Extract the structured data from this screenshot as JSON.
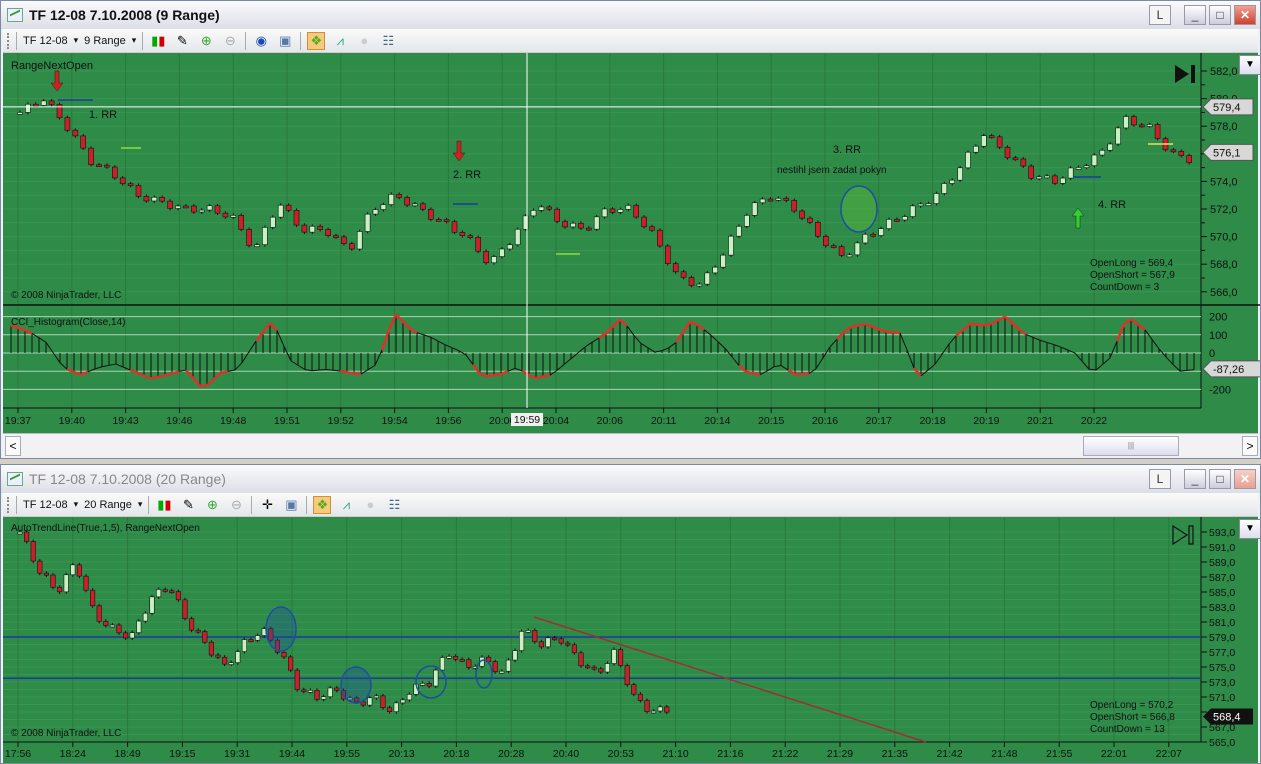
{
  "top_window": {
    "title": "TF 12-08  7.10.2008 (9 Range)",
    "buttons": {
      "layout": "L",
      "minimize": "_",
      "maximize": "□",
      "close": "✕"
    },
    "toolbar": {
      "instrument": "TF 12-08",
      "interval": "9 Range"
    },
    "indicator_label": "RangeNextOpen",
    "copyright": "© 2008 NinjaTrader, LLC",
    "cci_label": "CCI_Histogram(Close,14)",
    "annotations": [
      "1.  RR",
      "2.  RR",
      "3. RR",
      "nestihl jsem zadat pokyn",
      "4. RR"
    ],
    "stats": [
      "OpenLong = 569,4",
      "OpenShort = 567,9",
      "CountDown = 3"
    ],
    "price_axis": [
      "582,0",
      "580,0",
      "578,0",
      "576,0",
      "574,0",
      "572,0",
      "570,0",
      "568,0",
      "566,0"
    ],
    "price_tags": {
      "crosshair": "579,4",
      "last": "576,1"
    },
    "cci_axis": [
      "200",
      "100",
      "0",
      "-200"
    ],
    "cci_tag": "-87,26",
    "time_axis": [
      "19:37",
      "19:40",
      "19:43",
      "19:46",
      "19:48",
      "19:51",
      "19:52",
      "19:54",
      "19:56",
      "20:00",
      "20:04",
      "20:06",
      "20:11",
      "20:14",
      "20:15",
      "20:16",
      "20:17",
      "20:18",
      "20:19",
      "20:21",
      "20:22"
    ],
    "crosshair_time": "19:59",
    "scroll": {
      "left": "<",
      "right": ">",
      "thumb": "|||"
    }
  },
  "bottom_window": {
    "title": "TF 12-08  7.10.2008 (20 Range)",
    "buttons": {
      "layout": "L",
      "minimize": "_",
      "maximize": "□",
      "close": "✕"
    },
    "toolbar": {
      "instrument": "TF 12-08",
      "interval": "20 Range"
    },
    "indicator_label": "AutoTrendLine(True,1,5), RangeNextOpen",
    "copyright": "© 2008 NinjaTrader, LLC",
    "stats": [
      "OpenLong = 570,2",
      "OpenShort = 566,8",
      "CountDown = 13"
    ],
    "price_axis": [
      "593,0",
      "591,0",
      "589,0",
      "587,0",
      "585,0",
      "583,0",
      "581,0",
      "579,0",
      "577,0",
      "575,0",
      "573,0",
      "571,0",
      "569,0",
      "567,0",
      "565,0"
    ],
    "price_tag": "568,4",
    "time_axis": [
      "17:56",
      "18:24",
      "18:49",
      "19:15",
      "19:31",
      "19:44",
      "19:55",
      "20:13",
      "20:18",
      "20:28",
      "20:40",
      "20:53",
      "21:10",
      "21:16",
      "21:22",
      "21:29",
      "21:35",
      "21:42",
      "21:48",
      "21:55",
      "22:01",
      "22:07"
    ]
  },
  "chart_data": [
    {
      "type": "candlestick",
      "name": "TF 12-08 9 Range",
      "price_path": [
        579,
        580,
        578,
        575.5,
        574.5,
        573,
        572.5,
        572,
        572,
        571.5,
        569,
        572.5,
        570.5,
        570.5,
        569,
        572,
        573,
        572,
        571,
        570,
        568,
        570,
        572.5,
        571,
        570.5,
        572,
        572,
        570,
        567,
        566.5,
        569,
        572,
        573,
        572,
        570,
        568.5,
        570,
        571,
        572,
        573,
        575,
        577.5,
        576,
        574.5,
        574,
        575,
        576,
        578.5,
        578,
        576,
        575.5
      ],
      "crosshair_price": 579.4,
      "last": 576.1
    },
    {
      "type": "histogram",
      "name": "CCI(Close,14)",
      "values": [
        150,
        120,
        60,
        -80,
        -120,
        -80,
        -60,
        -100,
        -140,
        -120,
        -90,
        -200,
        -110,
        -90,
        60,
        180,
        -40,
        -100,
        -90,
        -100,
        -120,
        -60,
        220,
        120,
        90,
        40,
        0,
        -130,
        -120,
        -80,
        -140,
        -120,
        -40,
        40,
        100,
        190,
        60,
        0,
        40,
        180,
        110,
        20,
        -100,
        -120,
        -60,
        -120,
        -110,
        40,
        140,
        160,
        120,
        110,
        -140,
        -60,
        80,
        160,
        150,
        200,
        110,
        70,
        40,
        0,
        -110,
        -30,
        200,
        130,
        0,
        -100,
        -90
      ],
      "ylim": [
        -260,
        240
      ]
    },
    {
      "type": "candlestick",
      "name": "TF 12-08 20 Range",
      "price_path": [
        593,
        588,
        585,
        589,
        582,
        580,
        579,
        584,
        586,
        581,
        578,
        575,
        578,
        580,
        577,
        572,
        571,
        572,
        570,
        571,
        569,
        572,
        573,
        577,
        575,
        576,
        574,
        580,
        578,
        579,
        576,
        574,
        577,
        571,
        569,
        569.5
      ],
      "horizontal_lines": [
        579,
        573.5
      ],
      "last": 568.4
    }
  ]
}
